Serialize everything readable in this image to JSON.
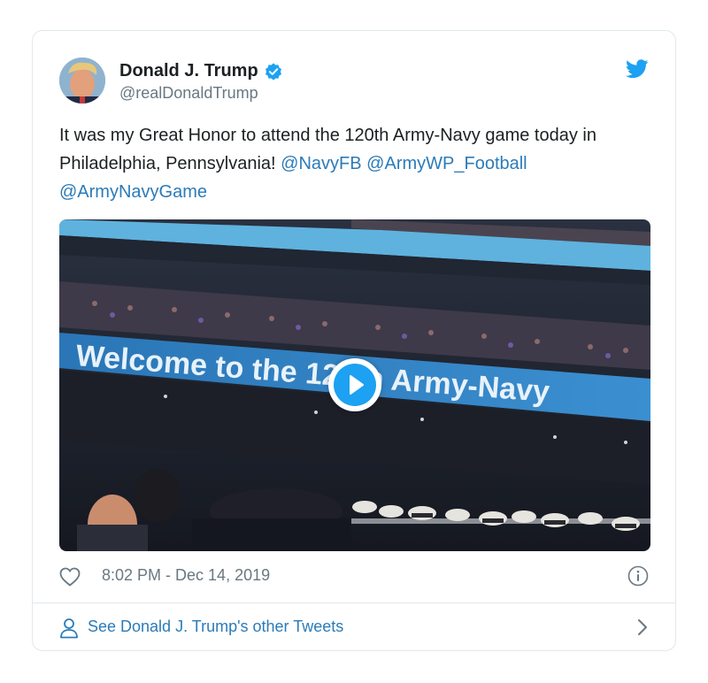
{
  "tweet": {
    "author_name": "Donald J. Trump",
    "author_handle": "@realDonaldTrump",
    "text_plain": "It was my Great Honor to attend the 120th Army-Navy game today in Philadelphia, Pennsylvania! ",
    "mentions": [
      "@NavyFB",
      "@ArmyWP_Football",
      "@ArmyNavyGame"
    ],
    "timestamp": "8:02 PM - Dec 14, 2019"
  },
  "media": {
    "banner_text": "Welcome to the 120th Army-Navy"
  },
  "footer": {
    "see_more_label": "See Donald J. Trump's other Tweets"
  },
  "icons": {
    "verified": "verified-badge-icon",
    "brand": "twitter-bird-icon",
    "like": "heart-icon",
    "info": "info-icon",
    "profile": "person-icon",
    "chevron": "chevron-right-icon"
  },
  "colors": {
    "accent": "#1da1f2",
    "link": "#2b7bb9",
    "muted": "#697882",
    "border": "#e1e8ed"
  }
}
